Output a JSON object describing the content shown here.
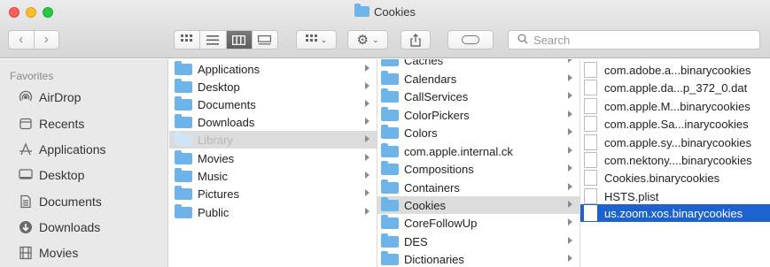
{
  "window": {
    "title": "Cookies"
  },
  "toolbar": {
    "back_glyph": "‹",
    "forward_glyph": "›",
    "view_icons": [
      "icon-view-icon",
      "list-view-icon",
      "column-view-icon",
      "gallery-view-icon"
    ],
    "search_placeholder": "Search"
  },
  "sidebar": {
    "heading": "Favorites",
    "items": [
      {
        "label": "AirDrop",
        "icon": "airdrop-icon"
      },
      {
        "label": "Recents",
        "icon": "recents-icon"
      },
      {
        "label": "Applications",
        "icon": "applications-icon"
      },
      {
        "label": "Desktop",
        "icon": "desktop-icon"
      },
      {
        "label": "Documents",
        "icon": "documents-icon"
      },
      {
        "label": "Downloads",
        "icon": "downloads-icon"
      },
      {
        "label": "Movies",
        "icon": "movies-icon"
      }
    ]
  },
  "column1": {
    "items": [
      {
        "label": "Applications",
        "state": "normal"
      },
      {
        "label": "Desktop",
        "state": "normal"
      },
      {
        "label": "Documents",
        "state": "normal"
      },
      {
        "label": "Downloads",
        "state": "normal"
      },
      {
        "label": "Library",
        "state": "selected-dim"
      },
      {
        "label": "Movies",
        "state": "normal"
      },
      {
        "label": "Music",
        "state": "normal"
      },
      {
        "label": "Pictures",
        "state": "normal"
      },
      {
        "label": "Public",
        "state": "normal"
      }
    ]
  },
  "column2": {
    "items": [
      {
        "label": "Caches",
        "state": "normal"
      },
      {
        "label": "Calendars",
        "state": "normal"
      },
      {
        "label": "CallServices",
        "state": "normal"
      },
      {
        "label": "ColorPickers",
        "state": "normal"
      },
      {
        "label": "Colors",
        "state": "normal"
      },
      {
        "label": "com.apple.internal.ck",
        "state": "normal"
      },
      {
        "label": "Compositions",
        "state": "normal"
      },
      {
        "label": "Containers",
        "state": "normal"
      },
      {
        "label": "Cookies",
        "state": "selected"
      },
      {
        "label": "CoreFollowUp",
        "state": "normal"
      },
      {
        "label": "DES",
        "state": "normal"
      },
      {
        "label": "Dictionaries",
        "state": "normal"
      }
    ]
  },
  "column3": {
    "items": [
      {
        "label": "com.adobe.a...binarycookies",
        "state": "normal"
      },
      {
        "label": "com.apple.da...p_372_0.dat",
        "state": "normal"
      },
      {
        "label": "com.apple.M...binarycookies",
        "state": "normal"
      },
      {
        "label": "com.apple.Sa...inarycookies",
        "state": "normal"
      },
      {
        "label": "com.apple.sy...binarycookies",
        "state": "normal"
      },
      {
        "label": "com.nektony....binarycookies",
        "state": "normal"
      },
      {
        "label": "Cookies.binarycookies",
        "state": "normal"
      },
      {
        "label": "HSTS.plist",
        "state": "normal"
      },
      {
        "label": "us.zoom.xos.binarycookies",
        "state": "active"
      }
    ]
  },
  "colors": {
    "accent_blue": "#1e62d0",
    "folder_blue": "#6cb4ea",
    "sidebar_bg": "#e9e9ea"
  }
}
